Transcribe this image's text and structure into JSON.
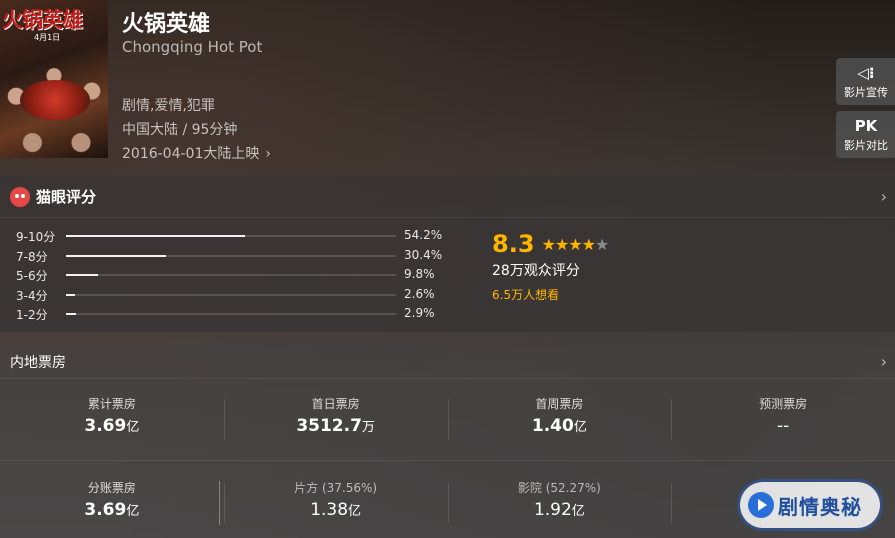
{
  "movie": {
    "poster_title": "火锅英雄",
    "poster_date": "4月1日",
    "title_cn": "火锅英雄",
    "title_en": "Chongqing Hot Pot",
    "genre": "剧情,爱情,犯罪",
    "region_duration": "中国大陆 / 95分钟",
    "release": "2016-04-01大陆上映",
    "release_chevron": "›"
  },
  "side_buttons": [
    {
      "icon": "speaker-icon",
      "icon_glyph": "◁⁝",
      "label": "影片宣传"
    },
    {
      "icon": "pk-icon",
      "icon_glyph": "PK",
      "label": "影片对比"
    }
  ],
  "rating": {
    "section_title": "猫眼评分",
    "chevron": "›",
    "distribution": [
      {
        "label": "9-10分",
        "percent": "54.2%",
        "value": 54.2
      },
      {
        "label": "7-8分",
        "percent": "30.4%",
        "value": 30.4
      },
      {
        "label": "5-6分",
        "percent": "9.8%",
        "value": 9.8
      },
      {
        "label": "3-4分",
        "percent": "2.6%",
        "value": 2.6
      },
      {
        "label": "1-2分",
        "percent": "2.9%",
        "value": 2.9
      }
    ],
    "score": "8.3",
    "stars_filled": 4,
    "stars_total": 5,
    "vote_count": "28万观众评分",
    "wish_count": "6.5万人想看",
    "accent_color": "#ffb400"
  },
  "box_office": {
    "section_title": "内地票房",
    "chevron": "›",
    "row1": [
      {
        "label": "累计票房",
        "value": "3.69",
        "unit": "亿"
      },
      {
        "label": "首日票房",
        "value": "3512.7",
        "unit": "万"
      },
      {
        "label": "首周票房",
        "value": "1.40",
        "unit": "亿"
      },
      {
        "label": "预测票房",
        "value": "--",
        "unit": ""
      }
    ],
    "row2": [
      {
        "label": "分账票房",
        "value": "3.69",
        "unit": "亿"
      },
      {
        "label": "片方 (37.56%)",
        "value": "1.38",
        "unit": "亿"
      },
      {
        "label": "影院 (52.27%)",
        "value": "1.92",
        "unit": "亿"
      }
    ]
  },
  "watermark": {
    "text": "剧情奥秘"
  }
}
